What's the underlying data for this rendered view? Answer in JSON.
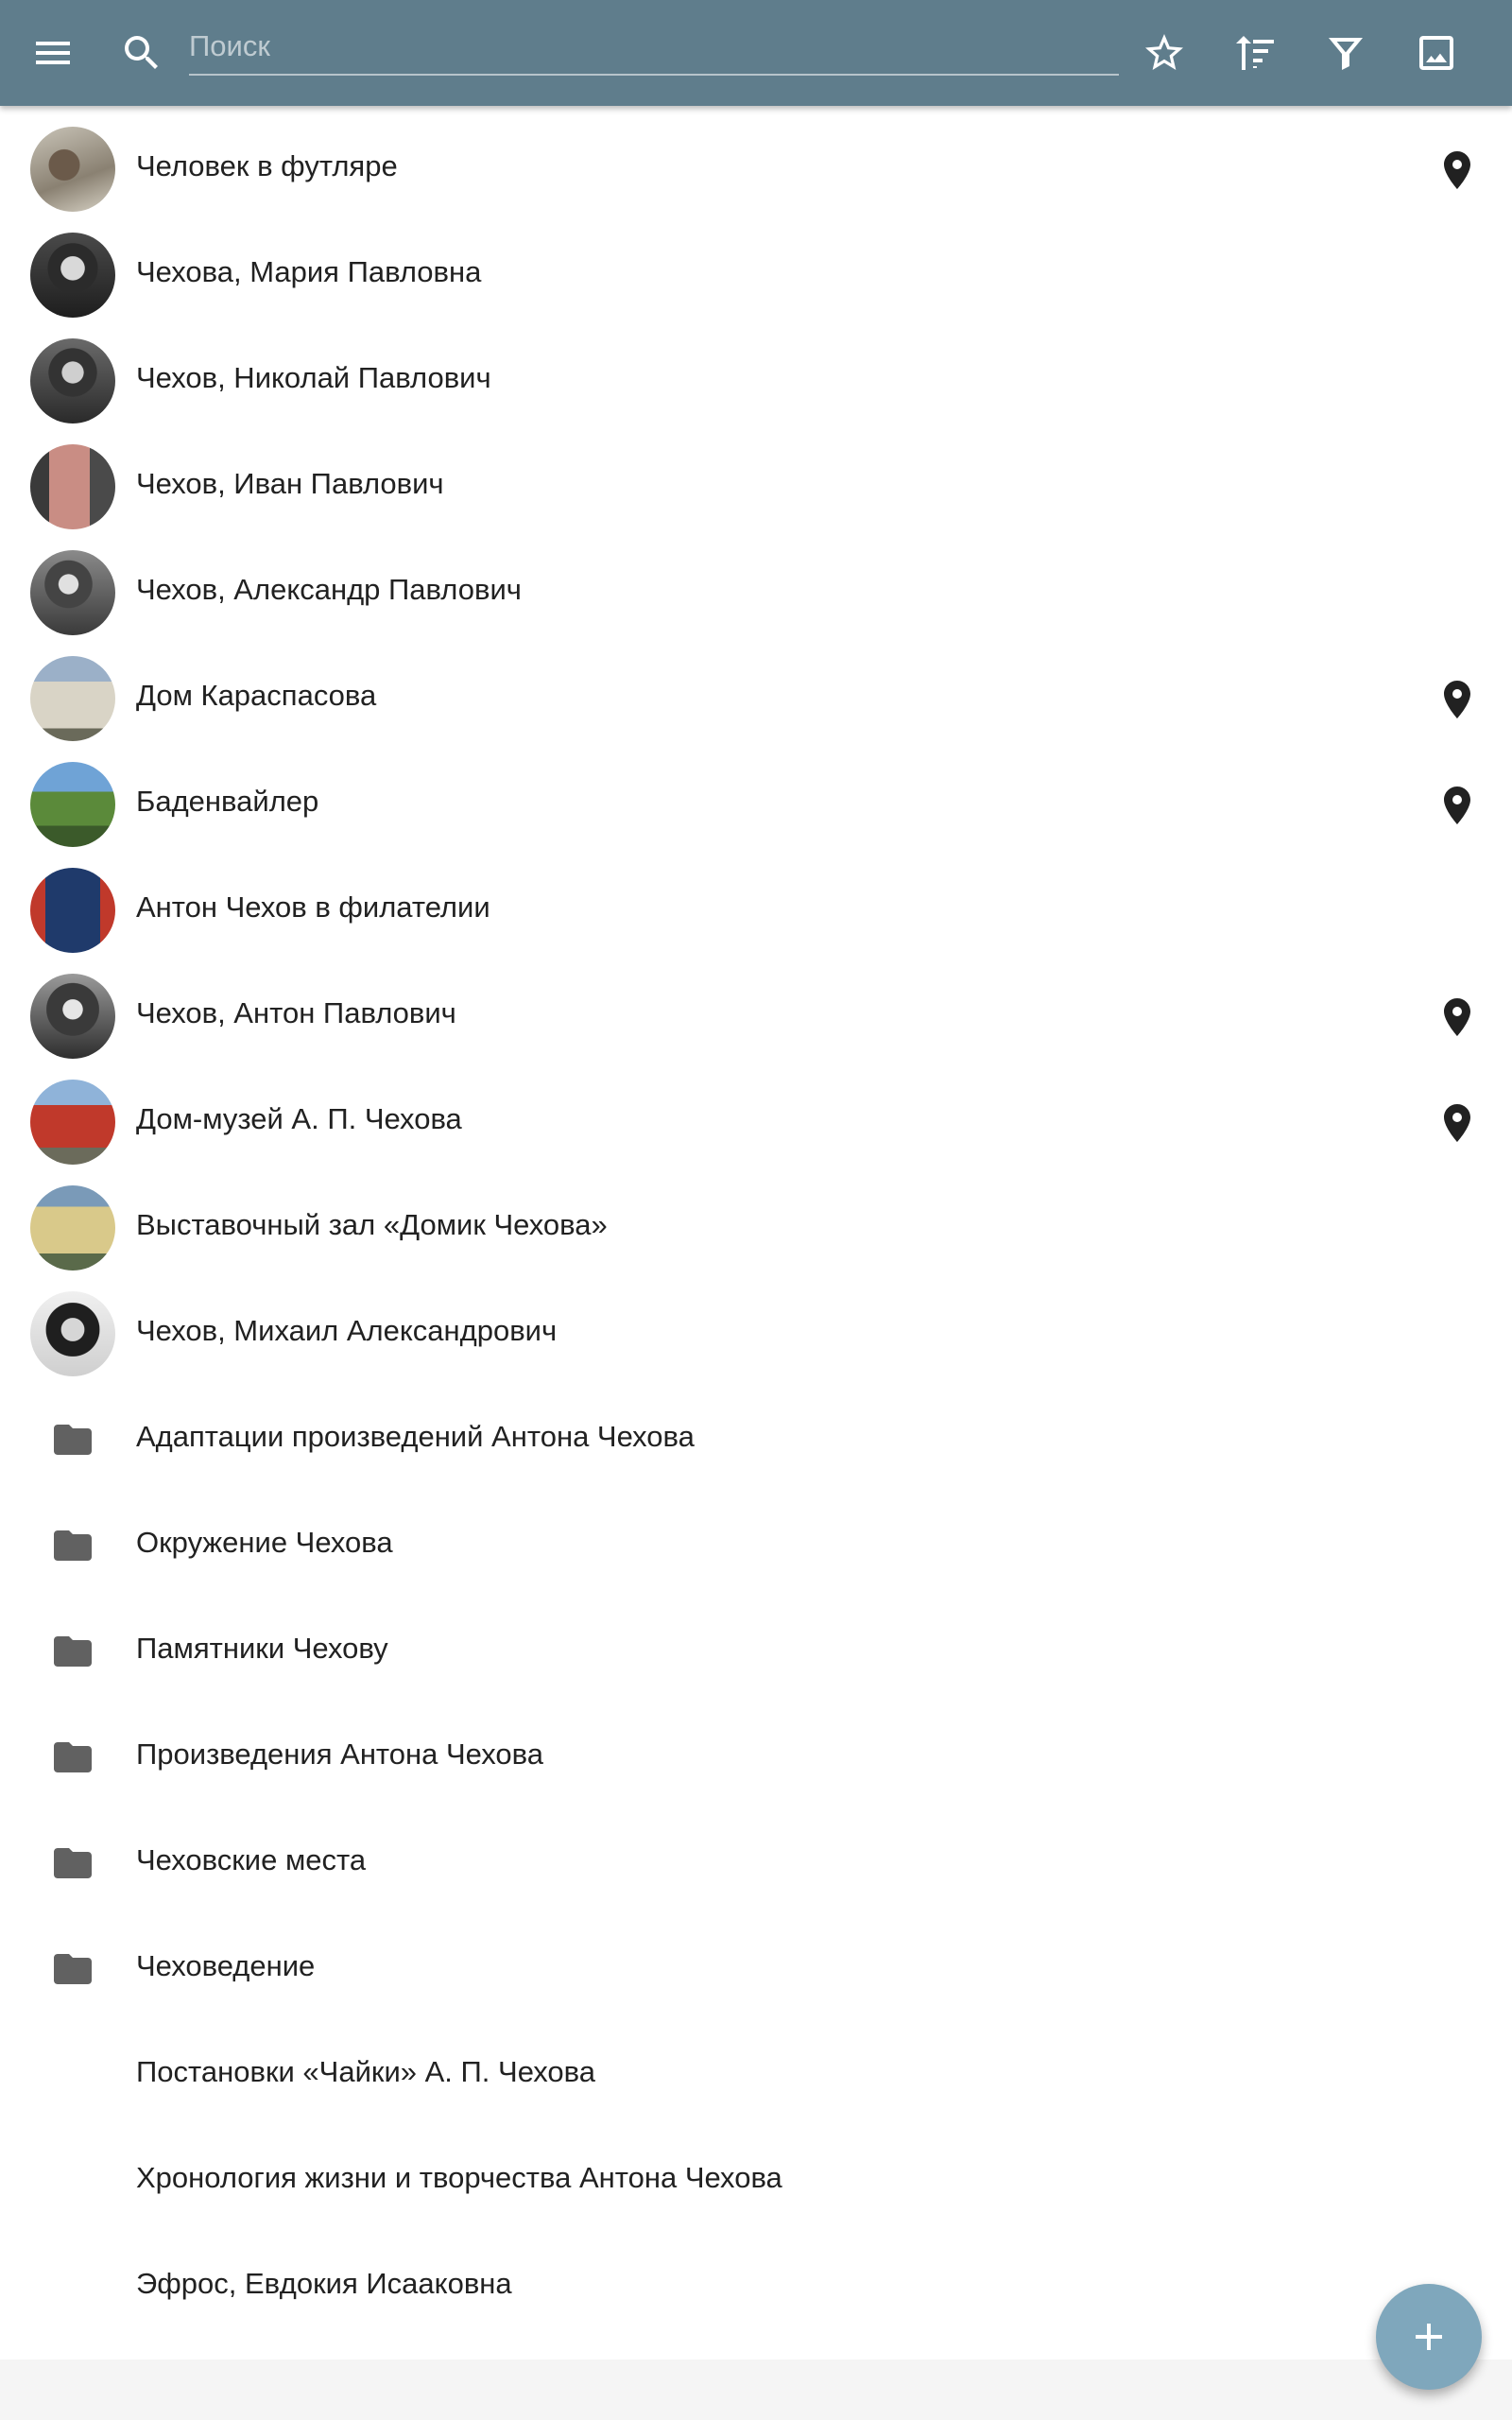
{
  "toolbar": {
    "background": "#5f7d8c",
    "menu_icon": "menu-icon",
    "search_icon": "search-icon",
    "search_placeholder": "Поиск",
    "search_value": "",
    "actions": [
      "star-outline-icon",
      "sort-icon",
      "filter-icon",
      "image-icon"
    ]
  },
  "list": {
    "items": [
      {
        "label": "Человек в футляре",
        "lead": "photo",
        "pin": true
      },
      {
        "label": "Чехова, Мария Павловна",
        "lead": "photo",
        "pin": false
      },
      {
        "label": "Чехов, Николай Павлович",
        "lead": "photo",
        "pin": false
      },
      {
        "label": "Чехов, Иван Павлович",
        "lead": "photo",
        "pin": false
      },
      {
        "label": "Чехов, Александр Павлович",
        "lead": "photo",
        "pin": false
      },
      {
        "label": "Дом Караспасова",
        "lead": "photo",
        "pin": true
      },
      {
        "label": "Баденвайлер",
        "lead": "photo",
        "pin": true
      },
      {
        "label": "Антон Чехов в филателии",
        "lead": "photo",
        "pin": false
      },
      {
        "label": "Чехов, Антон Павлович",
        "lead": "photo",
        "pin": true
      },
      {
        "label": "Дом-музей А. П. Чехова",
        "lead": "photo",
        "pin": true
      },
      {
        "label": "Выставочный зал «Домик Чехова»",
        "lead": "photo",
        "pin": false
      },
      {
        "label": "Чехов, Михаил Александрович",
        "lead": "photo",
        "pin": false
      },
      {
        "label": "Адаптации произведений Антона Чехова",
        "lead": "folder",
        "pin": false
      },
      {
        "label": "Окружение Чехова",
        "lead": "folder",
        "pin": false
      },
      {
        "label": "Памятники Чехову",
        "lead": "folder",
        "pin": false
      },
      {
        "label": "Произведения Антона Чехова",
        "lead": "folder",
        "pin": false
      },
      {
        "label": "Чеховские места",
        "lead": "folder",
        "pin": false
      },
      {
        "label": "Чеховедение",
        "lead": "folder",
        "pin": false
      },
      {
        "label": "Постановки «Чайки» А. П. Чехова",
        "lead": "none",
        "pin": false
      },
      {
        "label": "Хронология жизни и творчества Антона Чехова",
        "lead": "none",
        "pin": false
      },
      {
        "label": "Эфрос, Евдокия Исааковна",
        "lead": "none",
        "pin": false
      }
    ],
    "pin_icon": "map-marker-icon",
    "folder_icon": "folder-icon"
  },
  "fab": {
    "icon": "plus-icon",
    "color": "#7fa7bc"
  }
}
